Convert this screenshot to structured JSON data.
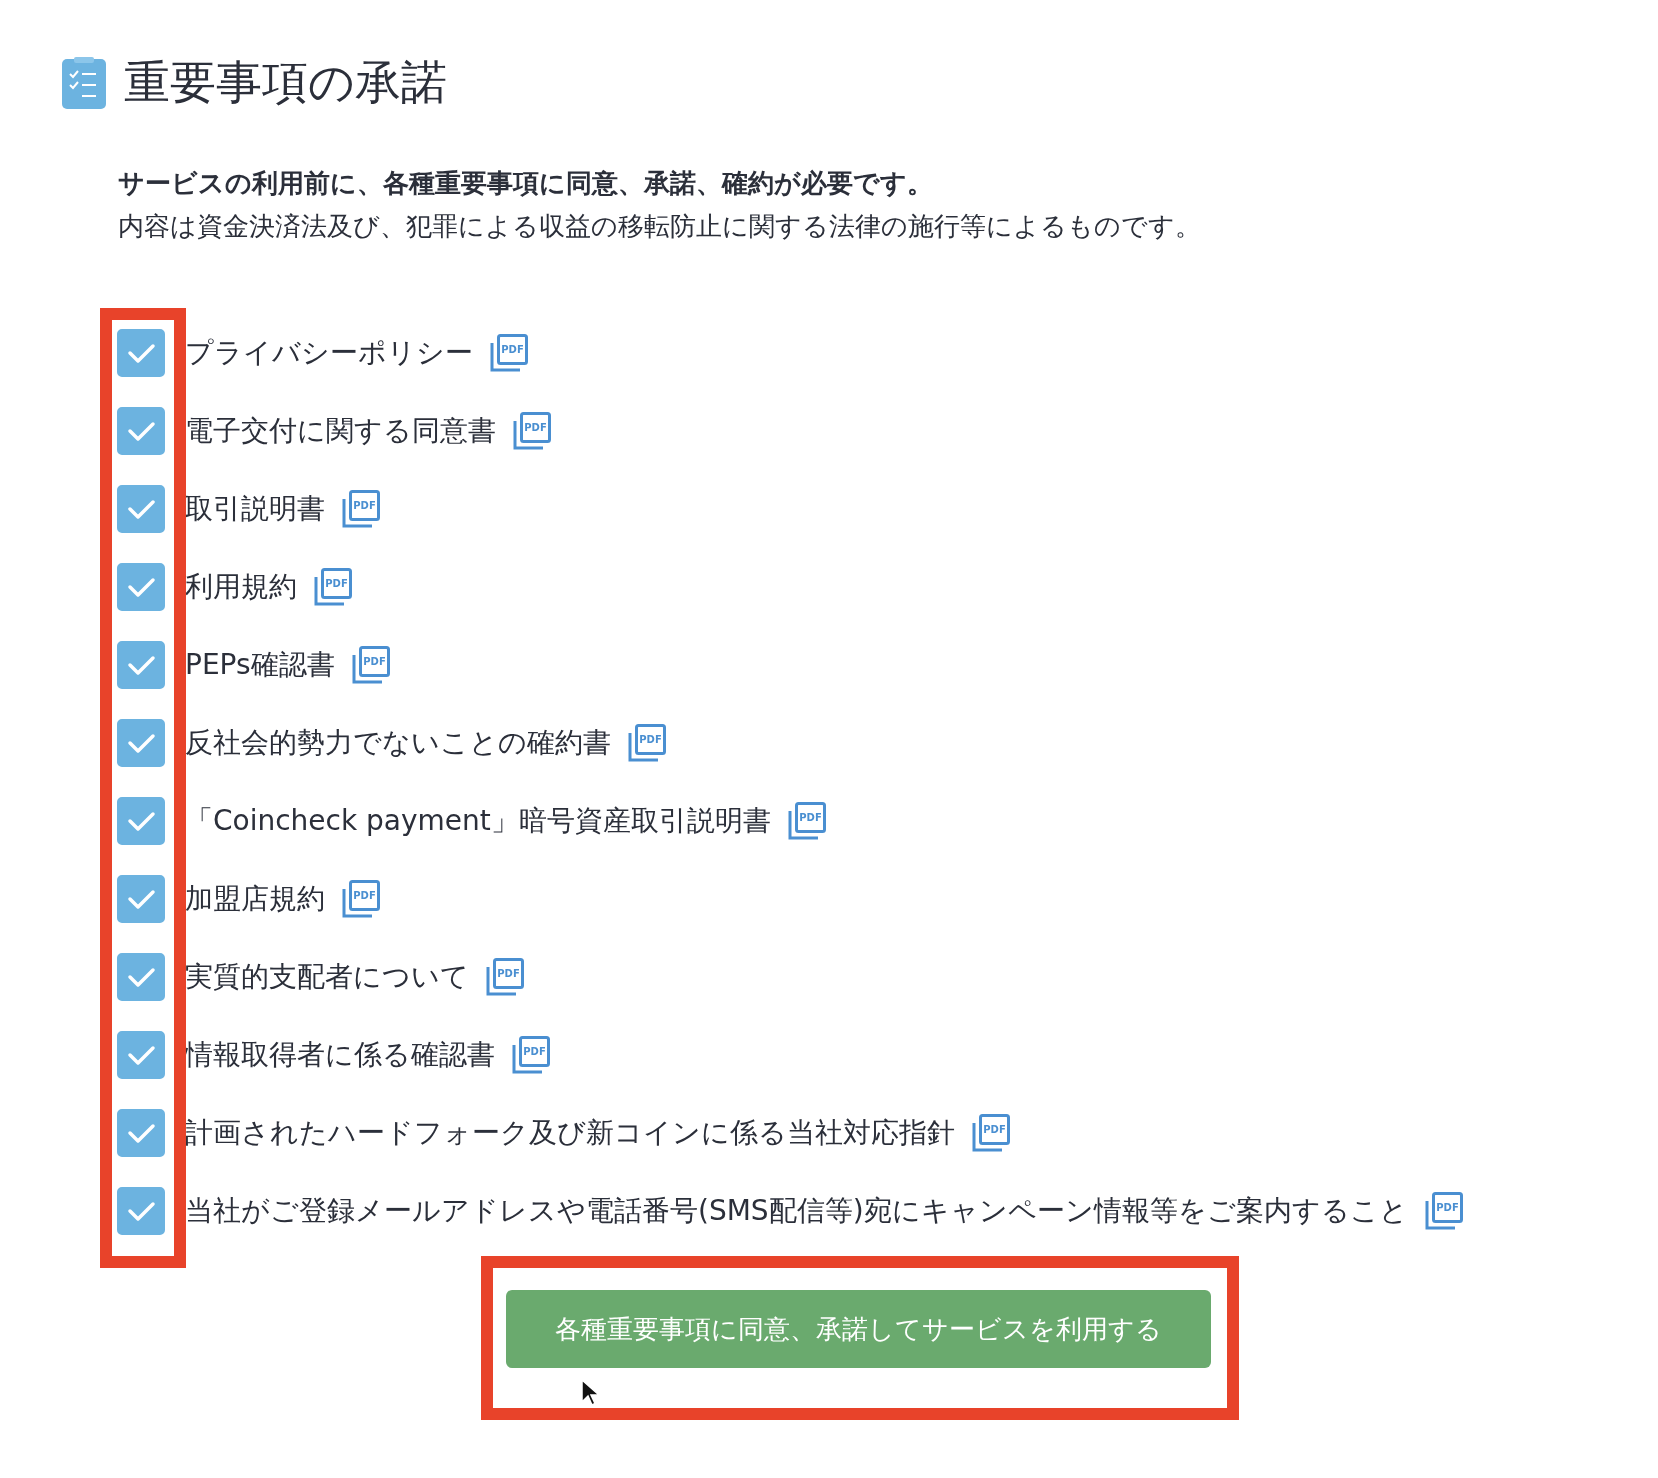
{
  "title": "重要事項の承諾",
  "intro": {
    "lead": "サービスの利用前に、各種重要事項に同意、承諾、確約が必要です。",
    "note": "内容は資金決済法及び、犯罪による収益の移転防止に関する法律の施行等によるものです。"
  },
  "agreements": [
    {
      "label": "プライバシーポリシー",
      "checked": true,
      "icon_text": "PDF"
    },
    {
      "label": "電子交付に関する同意書",
      "checked": true,
      "icon_text": "PDF"
    },
    {
      "label": "取引説明書",
      "checked": true,
      "icon_text": "PDF"
    },
    {
      "label": "利用規約",
      "checked": true,
      "icon_text": "PDF"
    },
    {
      "label": "PEPs確認書",
      "checked": true,
      "icon_text": "PDF"
    },
    {
      "label": "反社会的勢力でないことの確約書",
      "checked": true,
      "icon_text": "PDF"
    },
    {
      "label": "「Coincheck payment」暗号資産取引説明書",
      "checked": true,
      "icon_text": "PDF"
    },
    {
      "label": "加盟店規約",
      "checked": true,
      "icon_text": "PDF"
    },
    {
      "label": "実質的支配者について",
      "checked": true,
      "icon_text": "PDF"
    },
    {
      "label": "情報取得者に係る確認書",
      "checked": true,
      "icon_text": "PDF"
    },
    {
      "label": "計画されたハードフォーク及び新コインに係る当社対応指針",
      "checked": true,
      "icon_text": "PDF"
    },
    {
      "label": "当社がご登録メールアドレスや電話番号(SMS配信等)宛にキャンペーン情報等をご案内すること",
      "checked": true,
      "icon_text": "PDF"
    }
  ],
  "submit_button": "各種重要事項に同意、承諾してサービスを利用する"
}
